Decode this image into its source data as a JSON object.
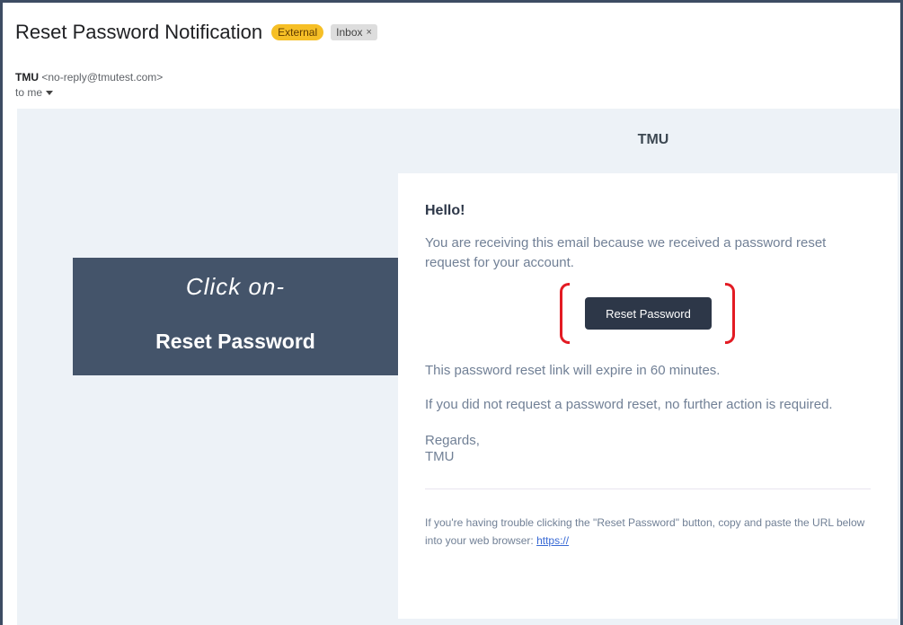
{
  "email": {
    "subject": "Reset Password Notification",
    "labels": {
      "external": "External",
      "inbox": "Inbox",
      "inbox_remove": "×"
    },
    "sender_name": "TMU",
    "sender_address": "<no-reply@tmutest.com>",
    "recipient": "to me"
  },
  "body": {
    "brand": "TMU",
    "greeting": "Hello!",
    "intro": "You are receiving this email because we received a password reset request for your account.",
    "button_label": "Reset Password",
    "expiry": "This password reset link will expire in 60 minutes.",
    "no_action": "If you did not request a password reset, no further action is required.",
    "regards": "Regards,",
    "signature": "TMU",
    "footer_text": "If you're having trouble clicking the \"Reset Password\" button, copy and paste the URL below into your web browser:",
    "footer_link": "https://"
  },
  "overlay": {
    "line1": "Click on-",
    "line2": "Reset Password"
  },
  "colors": {
    "frame": "#3d4c63",
    "button": "#2d3748",
    "highlight_bracket": "#e31b23",
    "overlay": "#44546a",
    "external_badge": "#f6bf26"
  }
}
